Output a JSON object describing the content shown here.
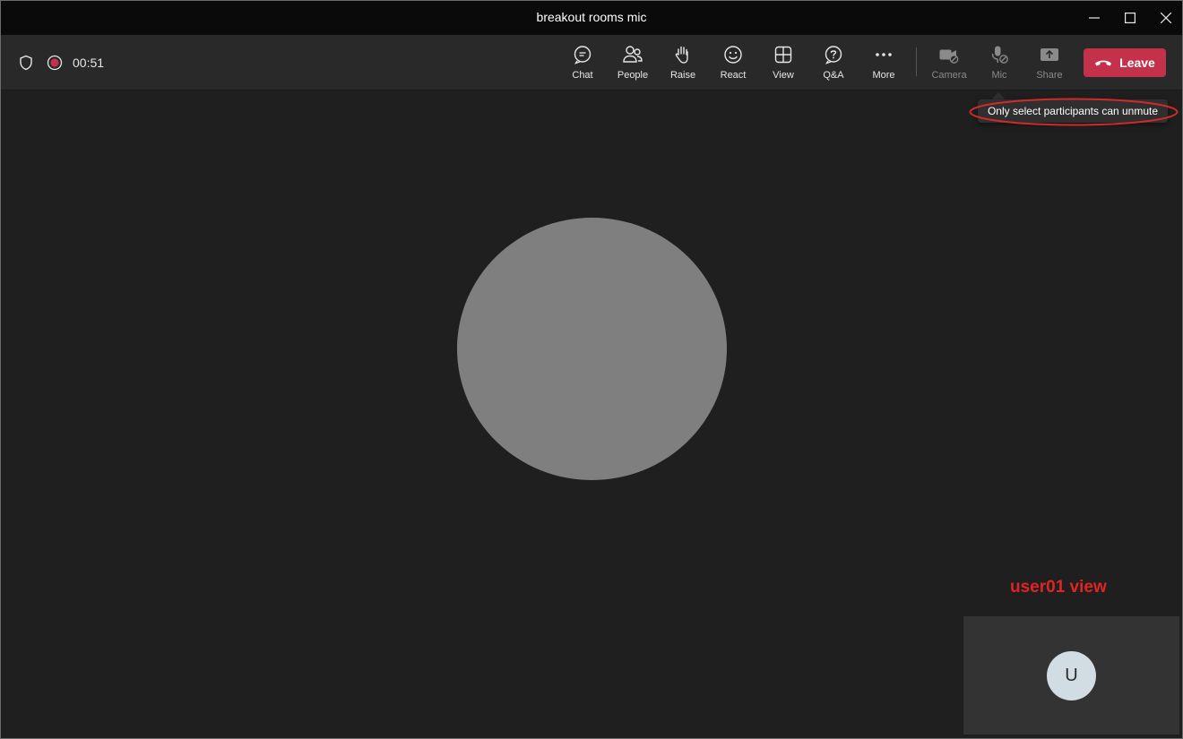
{
  "window": {
    "title": "breakout rooms mic"
  },
  "toolbar": {
    "timer": "00:51",
    "buttons": [
      {
        "label": "Chat",
        "icon": "chat-icon"
      },
      {
        "label": "People",
        "icon": "people-icon"
      },
      {
        "label": "Raise",
        "icon": "raise-hand-icon"
      },
      {
        "label": "React",
        "icon": "react-icon"
      },
      {
        "label": "View",
        "icon": "view-grid-icon"
      },
      {
        "label": "Q&A",
        "icon": "qna-icon"
      },
      {
        "label": "More",
        "icon": "more-icon"
      },
      {
        "label": "Camera",
        "icon": "camera-off-icon"
      },
      {
        "label": "Mic",
        "icon": "mic-off-icon"
      },
      {
        "label": "Share",
        "icon": "share-icon"
      }
    ],
    "leave_label": "Leave"
  },
  "tooltip": {
    "text": "Only select participants can unmute"
  },
  "annotation": {
    "label": "user01 view"
  },
  "self_view": {
    "initial": "U"
  },
  "colors": {
    "leave": "#c4314b",
    "annotation": "#e02424",
    "stage": "#1f1f1f",
    "toolbar": "#292929"
  }
}
